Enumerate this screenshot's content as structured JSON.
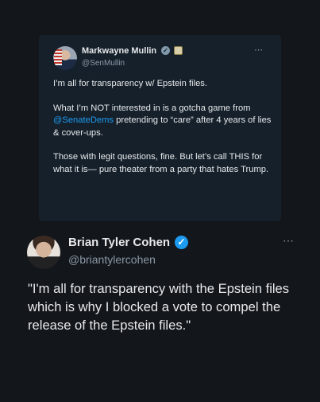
{
  "quoted_tweet": {
    "author_name": "Markwayne Mullin",
    "handle": "@SenMullin",
    "verified_icon": "verified-badge-icon",
    "more_icon": "⋯",
    "paragraph1": "I’m all for transparency w/ Epstein files.",
    "paragraph2_before": "What I’m NOT interested in is a gotcha game from ",
    "paragraph2_mention": "@SenateDems",
    "paragraph2_after": " pretending to “care” after 4 years of lies & cover-ups.",
    "paragraph3": "Those with legit questions, fine. But let’s call THIS for what it is— pure theater from a party that hates Trump."
  },
  "tweet": {
    "author_name": "Brian Tyler Cohen",
    "handle": "@briantylercohen",
    "verified_icon": "verified-badge-icon",
    "more_icon": "⋯",
    "text": "\"I'm all for transparency with the Epstein files which is why I blocked a vote to compel the release of the Epstein files.\""
  },
  "colors": {
    "background": "#13161b",
    "quoted_background": "#15202b",
    "mention": "#1d9bf0",
    "verified_blue": "#1d9bf0",
    "secondary_text": "#8b98a5"
  }
}
